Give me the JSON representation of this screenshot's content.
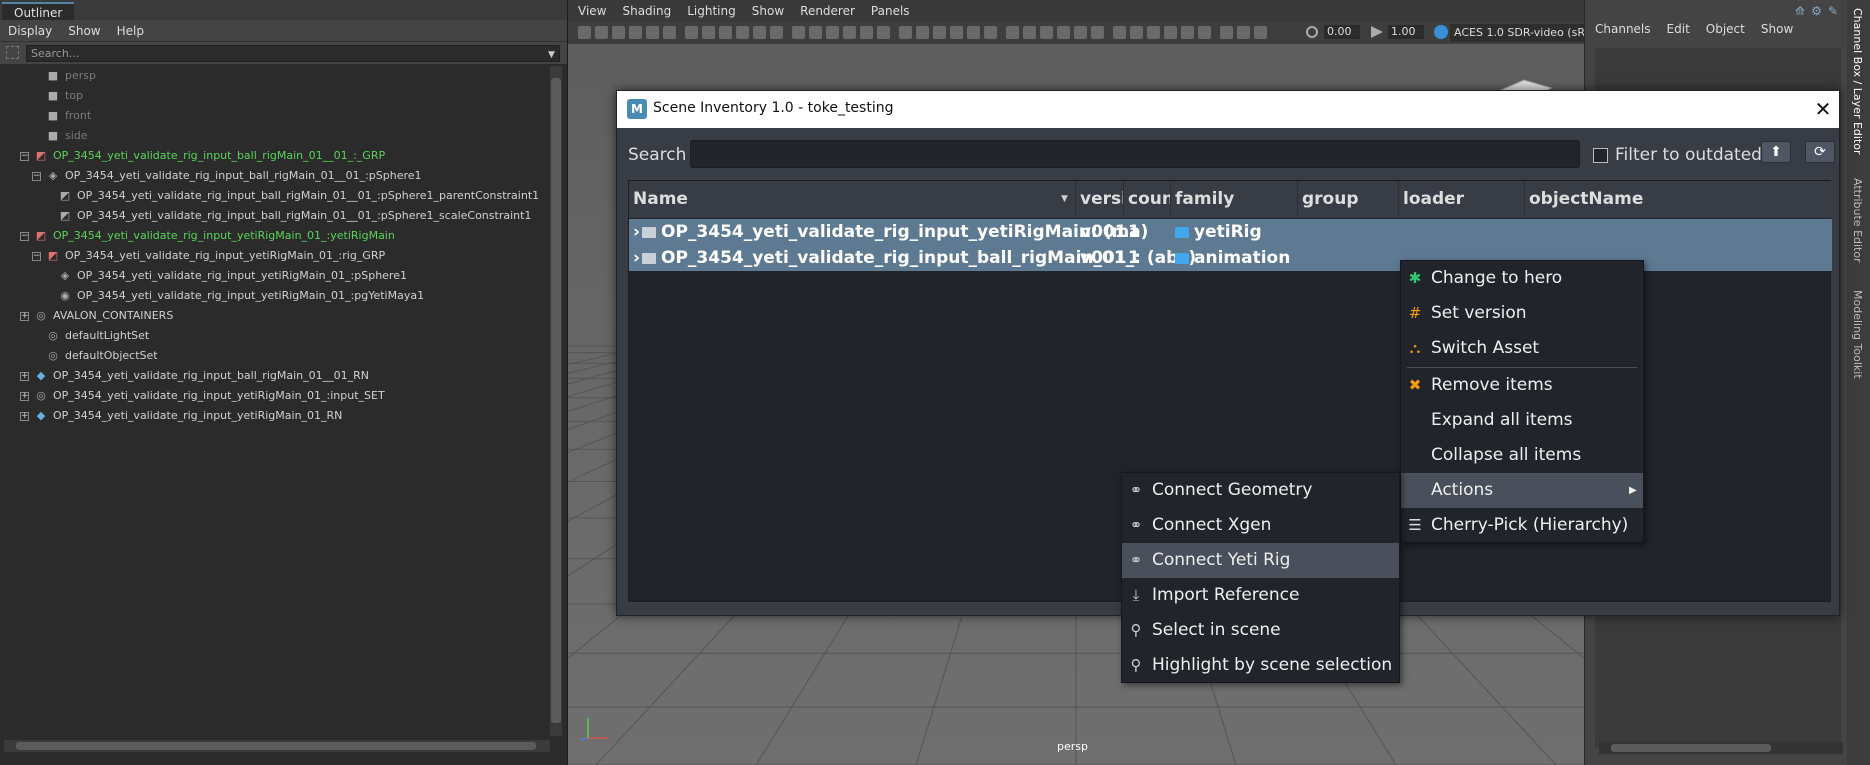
{
  "outliner": {
    "tab": "Outliner",
    "menu": [
      "Display",
      "Show",
      "Help"
    ],
    "search_placeholder": "Search...",
    "tree": [
      {
        "label": "persp",
        "indent": 1,
        "icon": "camera-icon",
        "expand": "",
        "style": "dim"
      },
      {
        "label": "top",
        "indent": 1,
        "icon": "camera-icon",
        "expand": "",
        "style": "dim"
      },
      {
        "label": "front",
        "indent": 1,
        "icon": "camera-icon",
        "expand": "",
        "style": "dim"
      },
      {
        "label": "side",
        "indent": 1,
        "icon": "camera-icon",
        "expand": "",
        "style": "dim"
      },
      {
        "label": "OP_3454_yeti_validate_rig_input_ball_rigMain_01__01_:_GRP",
        "indent": 0,
        "icon": "reference-group-icon",
        "expand": "−",
        "style": "green"
      },
      {
        "label": "OP_3454_yeti_validate_rig_input_ball_rigMain_01__01_:pSphere1",
        "indent": 1,
        "icon": "transform-icon",
        "expand": "−",
        "style": ""
      },
      {
        "label": "OP_3454_yeti_validate_rig_input_ball_rigMain_01__01_:pSphere1_parentConstraint1",
        "indent": 2,
        "icon": "constraint-icon",
        "expand": "",
        "style": ""
      },
      {
        "label": "OP_3454_yeti_validate_rig_input_ball_rigMain_01__01_:pSphere1_scaleConstraint1",
        "indent": 2,
        "icon": "constraint-icon",
        "expand": "",
        "style": ""
      },
      {
        "label": "OP_3454_yeti_validate_rig_input_yetiRigMain_01_:yetiRigMain",
        "indent": 0,
        "icon": "reference-group-icon",
        "expand": "−",
        "style": "green"
      },
      {
        "label": "OP_3454_yeti_validate_rig_input_yetiRigMain_01_:rig_GRP",
        "indent": 1,
        "icon": "reference-group-icon",
        "expand": "−",
        "style": ""
      },
      {
        "label": "OP_3454_yeti_validate_rig_input_yetiRigMain_01_:pSphere1",
        "indent": 2,
        "icon": "transform-icon",
        "expand": "",
        "style": ""
      },
      {
        "label": "OP_3454_yeti_validate_rig_input_yetiRigMain_01_:pgYetiMaya1",
        "indent": 2,
        "icon": "yeti-node-icon",
        "expand": "",
        "style": ""
      },
      {
        "label": "AVALON_CONTAINERS",
        "indent": 0,
        "icon": "set-icon",
        "expand": "+",
        "style": ""
      },
      {
        "label": "defaultLightSet",
        "indent": 1,
        "icon": "set-icon",
        "expand": "",
        "style": ""
      },
      {
        "label": "defaultObjectSet",
        "indent": 1,
        "icon": "set-icon",
        "expand": "",
        "style": ""
      },
      {
        "label": "OP_3454_yeti_validate_rig_input_ball_rigMain_01__01_RN",
        "indent": 0,
        "icon": "reference-node-icon",
        "expand": "+",
        "style": ""
      },
      {
        "label": "OP_3454_yeti_validate_rig_input_yetiRigMain_01_:input_SET",
        "indent": 0,
        "icon": "set-icon",
        "expand": "+",
        "style": ""
      },
      {
        "label": "OP_3454_yeti_validate_rig_input_yetiRigMain_01_RN",
        "indent": 0,
        "icon": "reference-node-icon",
        "expand": "+",
        "style": ""
      }
    ]
  },
  "viewport": {
    "menu": [
      "View",
      "Shading",
      "Lighting",
      "Show",
      "Renderer",
      "Panels"
    ],
    "exposure": "0.00",
    "gamma": "1.00",
    "color_space": "ACES 1.0 SDR-video (sRGB",
    "camera_label": "persp"
  },
  "channel_box": {
    "menu": [
      "Channels",
      "Edit",
      "Object",
      "Show"
    ],
    "side_tabs": [
      "Channel Box / Layer Editor",
      "Attribute Editor",
      "Modeling Toolkit"
    ]
  },
  "inventory": {
    "title": "Scene Inventory 1.0 - toke_testing",
    "logo": "M",
    "search_label": "Search",
    "search_value": "",
    "filter_label": "Filter to outdated",
    "filter_checked": false,
    "columns": [
      "Name",
      "versio",
      "count",
      "family",
      "group",
      "loader",
      "objectName"
    ],
    "rows": [
      {
        "name": "OP_3454_yeti_validate_rig_input_yetiRigMain: (ma)",
        "version": "v001",
        "count": "1",
        "family": "yetiRig",
        "group": "",
        "loader": "",
        "objectName": ""
      },
      {
        "name": "OP_3454_yeti_validate_rig_input_ball_rigMain_01_: (abc)",
        "version": "v001",
        "count": "1",
        "family": "animation",
        "group": "",
        "loader": "",
        "objectName": ""
      }
    ]
  },
  "context_menu": {
    "items": [
      {
        "label": "Change to hero",
        "icon": "asterisk-icon",
        "glyph": "✱",
        "color": "#2ecc71"
      },
      {
        "label": "Set version",
        "icon": "hash-icon",
        "glyph": "#",
        "color": "#f39c12"
      },
      {
        "label": "Switch Asset",
        "icon": "sitemap-icon",
        "glyph": "⛬",
        "color": "#f39c12"
      },
      {
        "label": "Remove items",
        "icon": "times-icon",
        "glyph": "✖",
        "color": "#f39c12"
      },
      {
        "label": "Expand all items",
        "icon": "",
        "glyph": "",
        "color": ""
      },
      {
        "label": "Collapse all items",
        "icon": "",
        "glyph": "",
        "color": ""
      },
      {
        "label": "Actions",
        "icon": "",
        "glyph": "",
        "color": "",
        "submenu": true
      },
      {
        "label": "Cherry-Pick (Hierarchy)",
        "icon": "list-icon",
        "glyph": "☰",
        "color": "#dddddd"
      }
    ]
  },
  "actions_submenu": {
    "items": [
      {
        "label": "Connect Geometry",
        "icon": "link-icon",
        "glyph": "⚭"
      },
      {
        "label": "Connect Xgen",
        "icon": "link-icon",
        "glyph": "⚭"
      },
      {
        "label": "Connect Yeti Rig",
        "icon": "link-icon",
        "glyph": "⚭"
      },
      {
        "label": "Import Reference",
        "icon": "download-icon",
        "glyph": "⤓"
      },
      {
        "label": "Select in scene",
        "icon": "search-icon",
        "glyph": "⚲"
      },
      {
        "label": "Highlight by scene selection",
        "icon": "search-icon",
        "glyph": "⚲"
      }
    ],
    "highlighted": 2
  },
  "colors": {
    "selection": "#5e7a93",
    "outliner_green": "#59d459",
    "inventory_bg": "#373c45"
  }
}
